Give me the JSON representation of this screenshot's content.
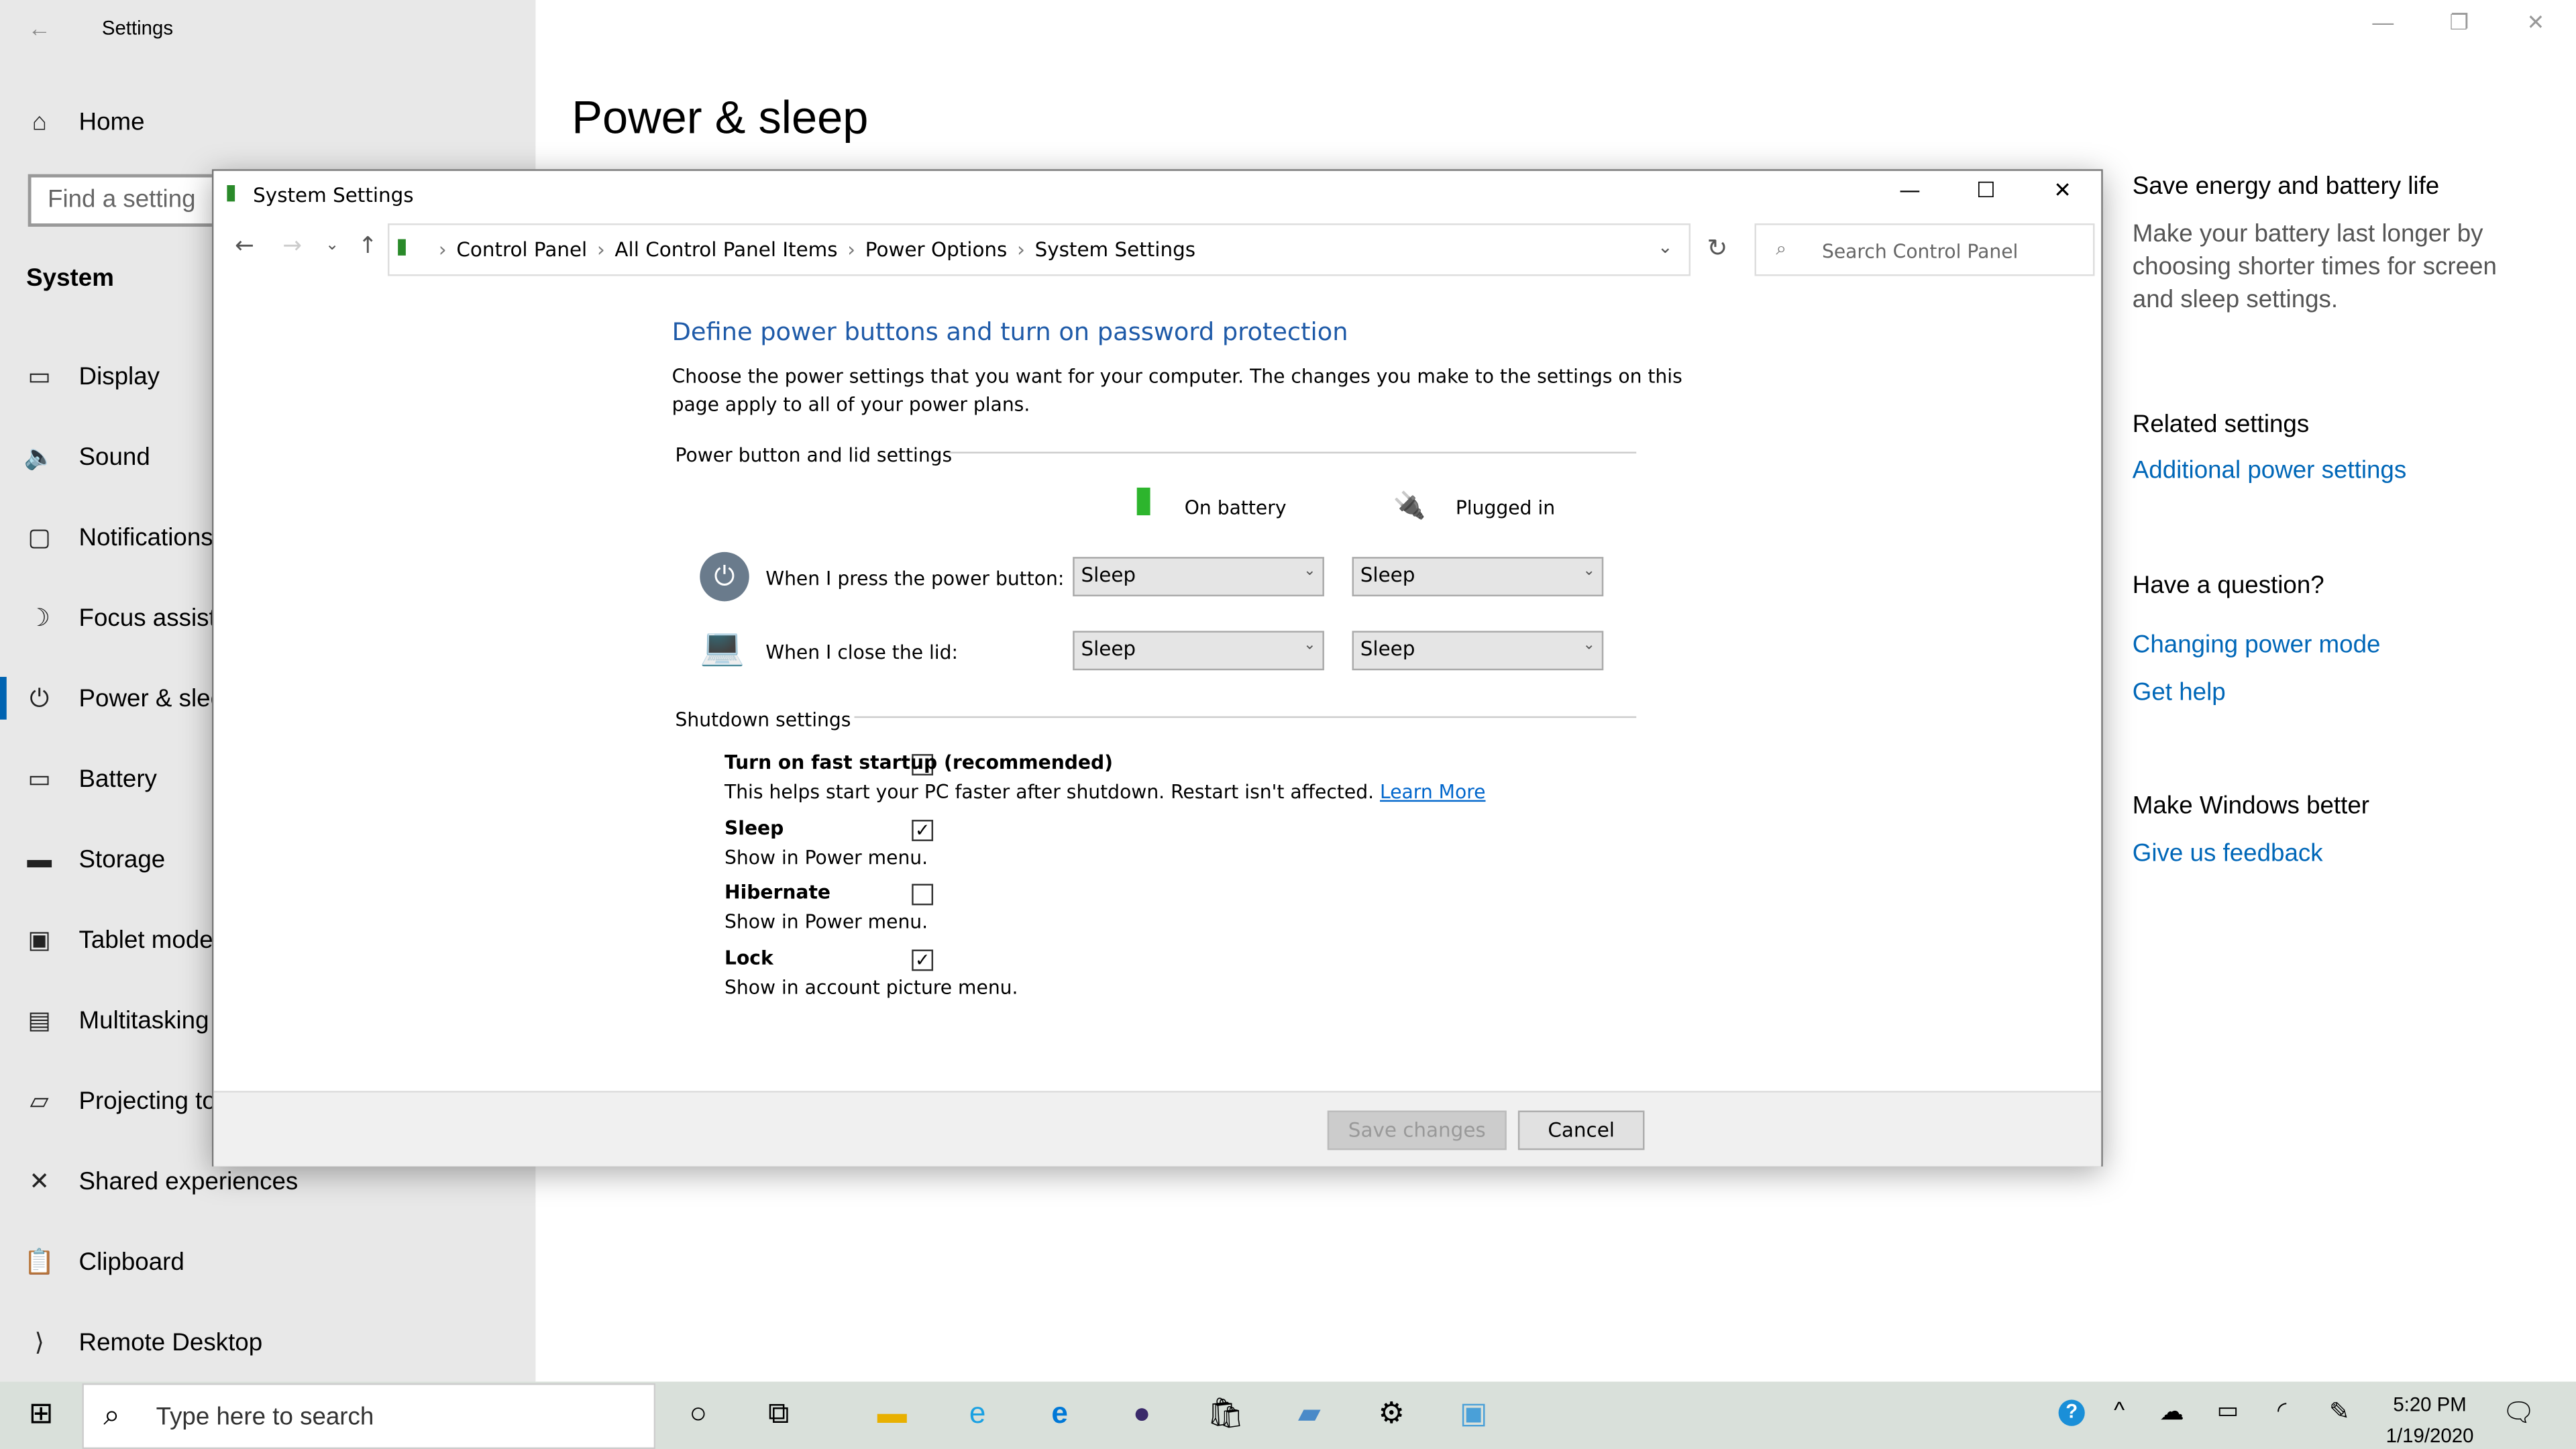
{
  "settings": {
    "title": "Settings",
    "page_title": "Power & sleep",
    "home": "Home",
    "search_placeholder": "Find a setting",
    "section": "System",
    "nav": [
      {
        "label": "Display",
        "icon": "monitor-icon"
      },
      {
        "label": "Sound",
        "icon": "speaker-icon"
      },
      {
        "label": "Notifications & actions",
        "icon": "notification-icon"
      },
      {
        "label": "Focus assist",
        "icon": "moon-icon"
      },
      {
        "label": "Power & sleep",
        "icon": "power-icon",
        "selected": true
      },
      {
        "label": "Battery",
        "icon": "battery-icon"
      },
      {
        "label": "Storage",
        "icon": "storage-icon"
      },
      {
        "label": "Tablet mode",
        "icon": "tablet-icon"
      },
      {
        "label": "Multitasking",
        "icon": "multitasking-icon"
      },
      {
        "label": "Projecting to this PC",
        "icon": "projector-icon"
      },
      {
        "label": "Shared experiences",
        "icon": "share-icon"
      },
      {
        "label": "Clipboard",
        "icon": "clipboard-icon"
      },
      {
        "label": "Remote Desktop",
        "icon": "remote-icon"
      }
    ],
    "right": {
      "h1": "Save energy and battery life",
      "p1": "Make your battery last longer by choosing shorter times for screen and sleep settings.",
      "h2": "Related settings",
      "l1": "Additional power settings",
      "h3": "Have a question?",
      "l2": "Changing power mode",
      "l3": "Get help",
      "h4": "Make Windows better",
      "l4": "Give us feedback"
    }
  },
  "dialog": {
    "title": "System Settings",
    "breadcrumb": [
      "Control Panel",
      "All Control Panel Items",
      "Power Options",
      "System Settings"
    ],
    "search_placeholder": "Search Control Panel",
    "heading": "Define power buttons and turn on password protection",
    "intro1": "Choose the power settings that you want for your computer. The changes you make to the settings on this",
    "intro2": "page apply to all of your power plans.",
    "group1": "Power button and lid settings",
    "col_battery": "On battery",
    "col_plugged": "Plugged in",
    "row1": {
      "label": "When I press the power button:",
      "battery": "Sleep",
      "plugged": "Sleep"
    },
    "row2": {
      "label": "When I close the lid:",
      "battery": "Sleep",
      "plugged": "Sleep"
    },
    "group2": "Shutdown settings",
    "options": [
      {
        "label": "Turn on fast startup (recommended)",
        "desc": "This helps start your PC faster after shutdown. Restart isn't affected.",
        "link": "Learn More",
        "checked": false
      },
      {
        "label": "Sleep",
        "desc": "Show in Power menu.",
        "checked": true
      },
      {
        "label": "Hibernate",
        "desc": "Show in Power menu.",
        "checked": false
      },
      {
        "label": "Lock",
        "desc": "Show in account picture menu.",
        "checked": true
      }
    ],
    "save": "Save changes",
    "cancel": "Cancel"
  },
  "taskbar": {
    "search_placeholder": "Type here to search",
    "time": "5:20 PM",
    "date": "1/19/2020"
  },
  "colors": {
    "accent": "#0067b8",
    "heading_blue": "#1e5aa8",
    "taskbar": "#d9e0da"
  }
}
